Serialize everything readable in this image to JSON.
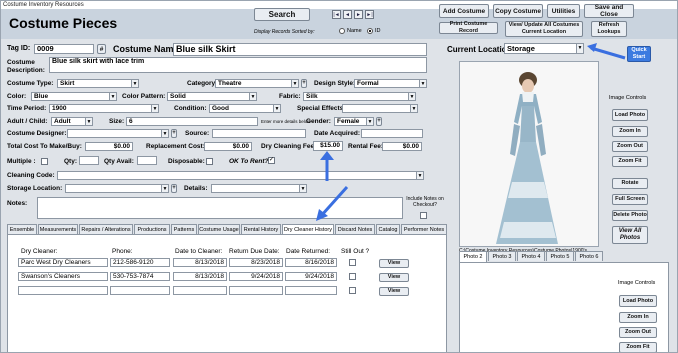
{
  "app_title": "Costume Inventory Resources",
  "form_title": "Costume Pieces",
  "header": {
    "search": "Search",
    "sorted_by": "Display Records Sorted by:",
    "sort_name": "Name",
    "sort_id": "ID",
    "nav": [
      "|◄",
      "◄",
      "►",
      "►|"
    ],
    "buttons": {
      "add": "Add Costume",
      "copy": "Copy Costume",
      "utilities": "Utilities",
      "save_close": "Save and Close",
      "print": "Print Costume Record",
      "view_update": "View/ Update All Costumes Current Location",
      "refresh": "Refresh Lookups"
    }
  },
  "quick_start": "Quick Start",
  "tag": {
    "label": "Tag ID:",
    "value": "0009",
    "hash": "#"
  },
  "name": {
    "label": "Costume Name:",
    "value": "Blue silk Skirt"
  },
  "description": {
    "label": "Costume Description:",
    "value": "Blue silk skirt with lace trim"
  },
  "location": {
    "label": "Current Location:",
    "value": "Storage"
  },
  "fields": {
    "type_label": "Costume Type:",
    "type": "Skirt",
    "category_label": "Category:",
    "category": "Theatre",
    "design_label": "Design Style:",
    "design": "Formal",
    "color_label": "Color:",
    "color": "Blue",
    "pattern_label": "Color Pattern:",
    "pattern": "Solid",
    "fabric_label": "Fabric:",
    "fabric": "Silk",
    "period_label": "Time Period:",
    "period": "1900",
    "condition_label": "Condition:",
    "condition": "Good",
    "effects_label": "Special Effects:",
    "effects": "",
    "adult_label": "Adult / Child:",
    "adult": "Adult",
    "size_label": "Size:",
    "size": "6",
    "size_hint": "Enter more details below",
    "gender_label": "Gender:",
    "gender": "Female",
    "designer_label": "Costume Designer:",
    "designer": "",
    "source_label": "Source:",
    "source": "",
    "acquired_label": "Date Acquired:",
    "acquired": "",
    "total_label": "Total Cost To Make/Buy:",
    "total": "$0.00",
    "replacement_label": "Replacement Cost:",
    "replacement": "$0.00",
    "dryfee_label": "Dry Cleaning Fee:",
    "dryfee": "$15.00",
    "rental_label": "Rental Fee:",
    "rental": "$0.00",
    "multiple_label": "Multiple :",
    "qty_label": "Qty:",
    "qtyavail_label": "Qty Avail:",
    "disposable_label": "Disposable:",
    "okrent_label": "OK To Rent?",
    "cleaning_label": "Cleaning Code:",
    "cleaning": "",
    "storage_label": "Storage Location:",
    "storage": "",
    "details_label": "Details:",
    "details": "",
    "notes_label": "Notes:",
    "notes": "",
    "checkout_label": "Include Notes on Checkout?"
  },
  "photo": {
    "path": "C:\\Costume Inventory Resources\\Costume Photos\\1900's dress.jpg",
    "controls_title": "Image Controls",
    "load": "Load Photo",
    "zoom_in": "Zoom In",
    "zoom_out": "Zoom Out",
    "zoom_fit": "Zoom Fit",
    "rotate": "Rotate",
    "full": "Full Screen",
    "delete": "Delete Photo",
    "view_all": "View All Photos"
  },
  "photo_tabs": [
    "Photo 2",
    "Photo 3",
    "Photo 4",
    "Photo 5",
    "Photo 6"
  ],
  "photo2": {
    "controls_title": "Image Controls",
    "load": "Load Photo",
    "zoom_in": "Zoom In",
    "zoom_out": "Zoom Out",
    "zoom_fit": "Zoom Fit"
  },
  "tabs": [
    "Ensemble",
    "Measurements",
    "Repairs / Alterations",
    "Productions",
    "Patterns",
    "Costume Usage",
    "Rental History",
    "Dry Cleaner History",
    "Discard Notes",
    "Catalog",
    "Performer Notes"
  ],
  "dry_table": {
    "headers": [
      "Dry Cleaner:",
      "Phone:",
      "Date to Cleaner:",
      "Return Due Date:",
      "Date Returned:",
      "Still Out ?"
    ],
    "rows": [
      {
        "cleaner": "Parc West Dry Cleaners",
        "phone": "212-586-9120",
        "to": "8/13/2018",
        "due": "8/23/2018",
        "returned": "8/16/2018",
        "view": "View"
      },
      {
        "cleaner": "Swanson's Cleaners",
        "phone": "530-753-7874",
        "to": "8/13/2018",
        "due": "9/24/2018",
        "returned": "9/24/2018",
        "view": "View"
      },
      {
        "cleaner": "",
        "phone": "",
        "to": "",
        "due": "",
        "returned": "",
        "view": "View"
      }
    ]
  },
  "colors": {
    "accent_arrow": "#3a6fe0",
    "header_bg": "#c9d3de",
    "form_bg": "#dfe3e8"
  }
}
